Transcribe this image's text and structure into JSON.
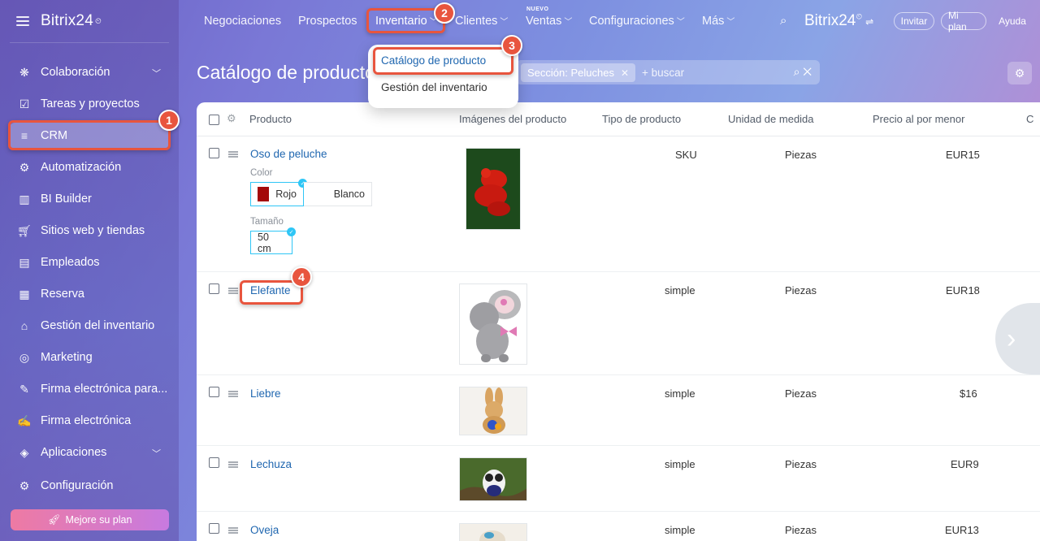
{
  "app": {
    "brand": "Bitrix24",
    "brand_mark": "⏲"
  },
  "sidebar": {
    "items": [
      {
        "label": "Colaboración",
        "icon": "collab-icon",
        "has_chevron": true
      },
      {
        "label": "Tareas y proyectos",
        "icon": "tasks-icon"
      },
      {
        "label": "CRM",
        "icon": "crm-icon",
        "active": true
      },
      {
        "label": "Automatización",
        "icon": "automation-icon"
      },
      {
        "label": "BI Builder",
        "icon": "bi-icon"
      },
      {
        "label": "Sitios web y tiendas",
        "icon": "cart-icon"
      },
      {
        "label": "Empleados",
        "icon": "employees-icon"
      },
      {
        "label": "Reserva",
        "icon": "booking-icon"
      },
      {
        "label": "Gestión del inventario",
        "icon": "inventory-icon"
      },
      {
        "label": "Marketing",
        "icon": "marketing-icon"
      },
      {
        "label": "Firma electrónica para...",
        "icon": "esign-icon"
      },
      {
        "label": "Firma electrónica",
        "icon": "signature-icon"
      },
      {
        "label": "Aplicaciones",
        "icon": "apps-icon",
        "has_chevron": true
      },
      {
        "label": "Configuración",
        "icon": "settings-icon"
      }
    ],
    "upgrade_label": "Mejore su plan"
  },
  "topnav": {
    "items": [
      "Negociaciones",
      "Prospectos",
      "Inventario",
      "Clientes",
      "Ventas",
      "Configuraciones",
      "Más"
    ],
    "new_tag": "NUEVO",
    "invite": "Invitar",
    "my_plan": "Mi plan",
    "help": "Ayuda"
  },
  "dropdown": {
    "items": [
      "Catálogo de producto",
      "Gestión del inventario"
    ]
  },
  "page": {
    "title": "Catálogo de productos",
    "filter_chip": "Sección: Peluches",
    "search_placeholder": "+ buscar"
  },
  "table": {
    "headers": [
      "Producto",
      "Imágenes del producto",
      "Tipo de producto",
      "Unidad de medida",
      "Precio al por menor",
      "C"
    ],
    "rows": [
      {
        "name": "Oso de peluche",
        "type": "SKU",
        "unit": "Piezas",
        "price": "EUR15"
      },
      {
        "name": "Elefante",
        "type": "simple",
        "unit": "Piezas",
        "price": "EUR18"
      },
      {
        "name": "Liebre",
        "type": "simple",
        "unit": "Piezas",
        "price": "$16"
      },
      {
        "name": "Lechuza",
        "type": "simple",
        "unit": "Piezas",
        "price": "EUR9"
      },
      {
        "name": "Oveja",
        "type": "simple",
        "unit": "Piezas",
        "price": "EUR13"
      }
    ],
    "variant": {
      "color_label": "Color",
      "color_options": [
        "Rojo",
        "Blanco"
      ],
      "size_label": "Tamaño",
      "size_options": [
        "50 cm"
      ]
    }
  },
  "steps": [
    "1",
    "2",
    "3",
    "4"
  ],
  "colors": {
    "accent": "#2067b0",
    "highlight": "#e8553e",
    "selected_border": "#2fc6f6"
  }
}
